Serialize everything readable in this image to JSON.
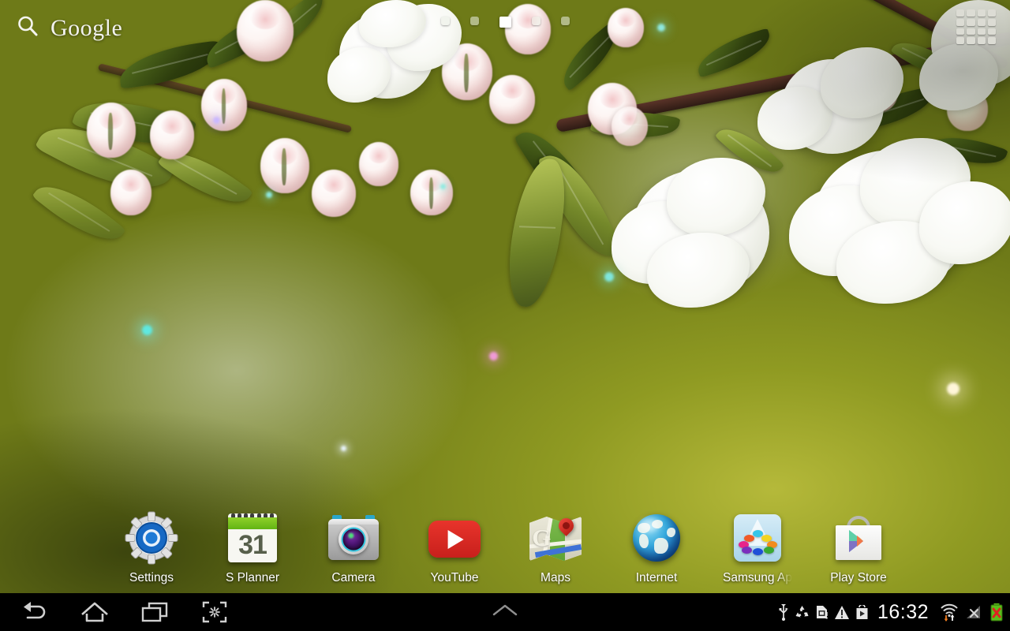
{
  "device": {
    "platform": "Android",
    "screen": "home-screen"
  },
  "search_widget": {
    "label": "Google",
    "icon": "search-icon"
  },
  "page_indicator": {
    "total_pages": 5,
    "active_page": 3,
    "dots": [
      "1",
      "2",
      "3",
      "4",
      "5"
    ]
  },
  "apps_button": {
    "icon": "apps-grid-icon",
    "label": "Apps"
  },
  "app_row": {
    "apps": [
      {
        "label": "Settings",
        "icon": "settings-gear-icon"
      },
      {
        "label": "S Planner",
        "icon": "calendar-icon",
        "badge": "31"
      },
      {
        "label": "Camera",
        "icon": "camera-icon"
      },
      {
        "label": "YouTube",
        "icon": "youtube-icon"
      },
      {
        "label": "Maps",
        "icon": "maps-icon",
        "glyph": "G"
      },
      {
        "label": "Internet",
        "icon": "globe-icon"
      },
      {
        "label": "Samsung Ap",
        "icon": "samsung-apps-icon",
        "truncated": true
      },
      {
        "label": "Play Store",
        "icon": "play-store-icon"
      }
    ]
  },
  "navbar": {
    "buttons": [
      {
        "name": "back",
        "icon": "back-arrow-icon"
      },
      {
        "name": "home",
        "icon": "home-icon"
      },
      {
        "name": "recents",
        "icon": "recent-apps-icon"
      },
      {
        "name": "screenshot",
        "icon": "screen-capture-icon"
      }
    ],
    "handle": {
      "icon": "chevron-up-icon"
    },
    "status": {
      "icons": [
        {
          "name": "usb",
          "icon": "usb-icon"
        },
        {
          "name": "recycle",
          "icon": "recycle-icon"
        },
        {
          "name": "sim",
          "icon": "sim-card-alert-icon"
        },
        {
          "name": "warning",
          "icon": "warning-triangle-icon"
        },
        {
          "name": "store",
          "icon": "play-bag-icon"
        }
      ],
      "clock": "16:32",
      "wifi": {
        "icon": "wifi-icon",
        "activity": "up-down-arrows"
      },
      "signal": {
        "icon": "signal-no-service-icon"
      },
      "battery": {
        "icon": "battery-error-icon"
      }
    }
  },
  "colors": {
    "youtube_red": "#d8271f",
    "planner_green": "#62b414",
    "settings_blue": "#1565c0",
    "globe_blue": "#1461b4",
    "wallpaper_green": "#6e7a22",
    "nav_background": "#000000",
    "label_white": "#ffffff"
  },
  "wallpaper": {
    "description": "white blossom branch",
    "theme": "flowers"
  }
}
